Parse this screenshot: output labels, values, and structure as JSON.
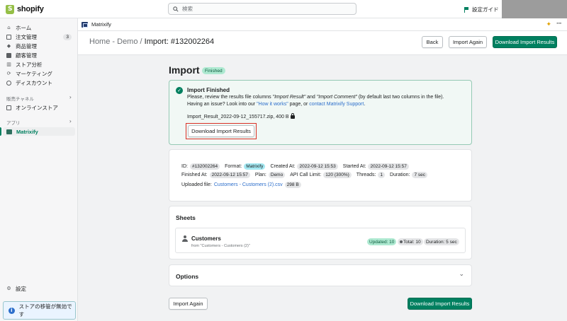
{
  "topbar": {
    "brand": "shopify",
    "search_placeholder": "検索",
    "setup_guide": "設定ガイド"
  },
  "sidebar": {
    "items": [
      {
        "label": "ホーム",
        "icon": "home-icon"
      },
      {
        "label": "注文管理",
        "icon": "orders-icon",
        "badge": "3"
      },
      {
        "label": "商品管理",
        "icon": "tag-icon"
      },
      {
        "label": "顧客管理",
        "icon": "customer-icon"
      },
      {
        "label": "ストア分析",
        "icon": "analytics-icon"
      },
      {
        "label": "マーケティング",
        "icon": "marketing-icon"
      },
      {
        "label": "ディスカウント",
        "icon": "discount-icon"
      }
    ],
    "sales_channels_label": "販売チャネル",
    "online_store": "オンラインストア",
    "apps_label": "アプリ",
    "active_app": "Matrixify",
    "settings": "設定",
    "transfer_notice": "ストアの移管が無効です"
  },
  "app": {
    "name": "Matrixify"
  },
  "header": {
    "crumb_home": "Home",
    "crumb_sep1": " - ",
    "crumb_demo": "Demo",
    "crumb_sep2": " / ",
    "crumb_current": "Import: #132002264",
    "back_label": "Back",
    "import_again_label": "Import Again",
    "download_label": "Download Import Results"
  },
  "main": {
    "title": "Import",
    "status": "Finished",
    "success": {
      "title": "Import Finished",
      "line1_a": "Please, review the results file columns ",
      "line1_b": "\"Import Result\"",
      "line1_c": " and ",
      "line1_d": "\"Import Comment\"",
      "line1_e": " (by default last two columns in the file).",
      "line2_a": "Having an issue? Look into our ",
      "line2_link1": "\"How it works\"",
      "line2_b": " page, or ",
      "line2_link2": "contact Matrixify Support",
      "line2_c": ".",
      "file": "Import_Result_2022-09-12_155717.zip, 400 B",
      "download_button": "Download Import Results"
    },
    "details": {
      "id_label": "ID:",
      "id": "#132002264",
      "format_label": "Format:",
      "format": "Matrixify",
      "created_label": "Created At:",
      "created": "2022-09-12 15:53",
      "started_label": "Started At:",
      "started": "2022-09-12 15:57",
      "finished_label": "Finished At:",
      "finished": "2022-09-12 15:57",
      "plan_label": "Plan:",
      "plan": "Demo",
      "api_label": "API Call Limit:",
      "api": "120 (300%)",
      "threads_label": "Threads:",
      "threads": "1",
      "duration_label": "Duration:",
      "duration": "7 sec",
      "uploaded_label": "Uploaded file:",
      "uploaded_file": "Customers - Customers (2).csv",
      "uploaded_size": "298 B"
    },
    "sheets": {
      "title": "Sheets",
      "name": "Customers",
      "source": "from \"Customers - Customers (2)\"",
      "updated": "Updated: 10",
      "total": "Total: 10",
      "duration": "Duration: 5 sec"
    },
    "options_title": "Options",
    "bottom_import_again": "Import Again",
    "bottom_download": "Download Import Results"
  },
  "colors": {
    "accent": "#008060",
    "highlight": "#d93025",
    "link": "#2c6ecb"
  }
}
